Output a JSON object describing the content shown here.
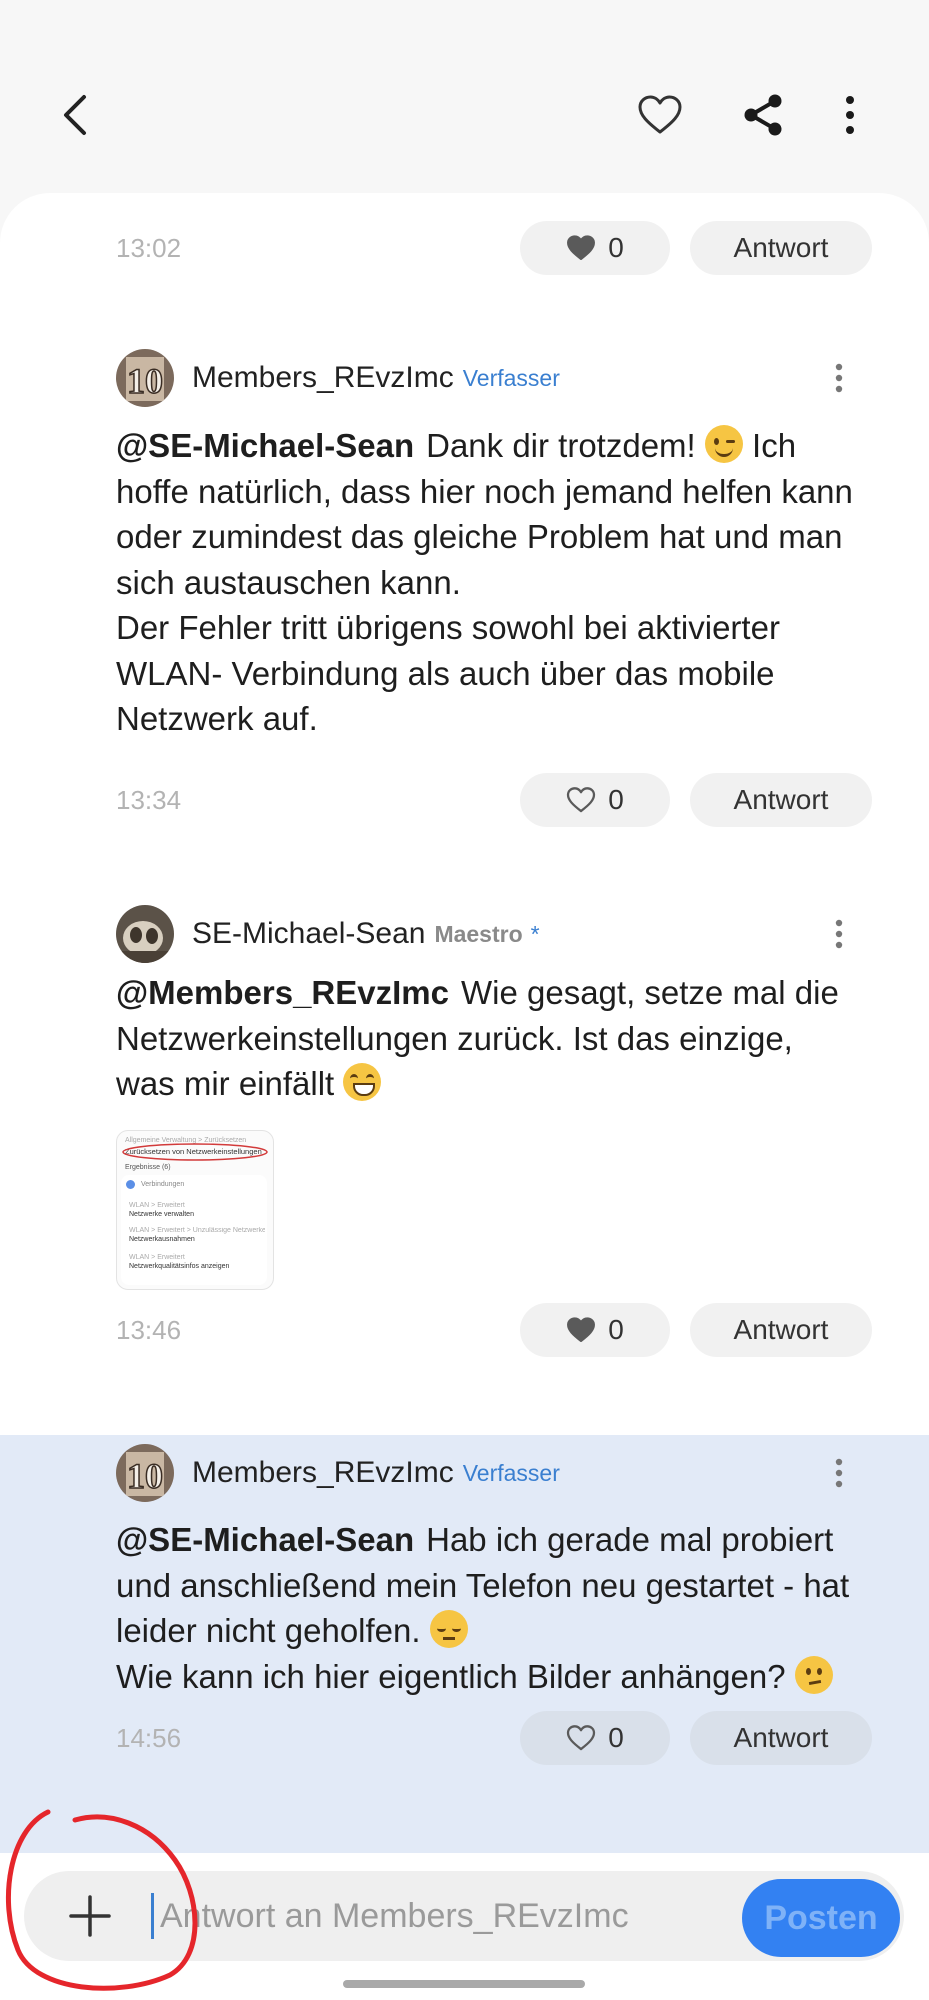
{
  "colors": {
    "accent": "#3a7fd0",
    "highlight_bg": "#e2eaf7",
    "post_button": "#3381f2"
  },
  "topbar": {
    "icons": [
      "back-arrow-icon",
      "heart-outline-icon",
      "share-icon",
      "more-vertical-icon"
    ]
  },
  "posts": [
    {
      "time": "13:02",
      "likes": "0",
      "liked": true,
      "reply_label": "Antwort"
    },
    {
      "author": "Members_REvzImc",
      "badge": "Verfasser",
      "mention": "@SE-Michael-Sean",
      "text_1": "Dank dir trotzdem!",
      "text_2": " Ich hoffe natürlich, dass hier noch jemand helfen kann oder zumindest das gleiche Problem hat und man sich austauschen kann.",
      "text_3": "Der Fehler tritt übrigens sowohl bei aktivierter WLAN- Verbindung als auch über das mobile Netzwerk auf.",
      "time": "13:34",
      "likes": "0",
      "liked": false,
      "reply_label": "Antwort"
    },
    {
      "author": "SE-Michael-Sean",
      "badge": "Maestro",
      "star": "*",
      "mention": "@Members_REvzImc",
      "text_1": "Wie gesagt, setze mal die Netzwerkeinstellungen zurück. Ist das einzige, was mir einfällt",
      "attachment": {
        "breadcrumb": "Allgemeine Verwaltung > Zurücksetzen",
        "title": "Zurücksetzen von Netzwerkeinstellungen",
        "results": "Ergebnisse (6)",
        "section": "Verbindungen",
        "items": [
          {
            "path": "WLAN > Erweitert",
            "label": "Netzwerke verwalten"
          },
          {
            "path": "WLAN > Erweitert > Unzulässige Netzwerke entfernen",
            "label": "Netzwerkausnahmen"
          },
          {
            "path": "WLAN > Erweitert",
            "label": "Netzwerkqualitätsinfos anzeigen"
          }
        ]
      },
      "time": "13:46",
      "likes": "0",
      "liked": true,
      "reply_label": "Antwort"
    },
    {
      "author": "Members_REvzImc",
      "badge": "Verfasser",
      "mention": "@SE-Michael-Sean",
      "text_1": "Hab ich gerade mal probiert und anschließend mein Telefon neu gestartet - hat leider nicht geholfen.",
      "text_2": "Wie kann ich hier eigentlich Bilder anhängen?",
      "time": "14:56",
      "likes": "0",
      "liked": false,
      "reply_label": "Antwort"
    }
  ],
  "composer": {
    "placeholder": "Antwort an Members_REvzImc",
    "post_label": "Posten"
  }
}
